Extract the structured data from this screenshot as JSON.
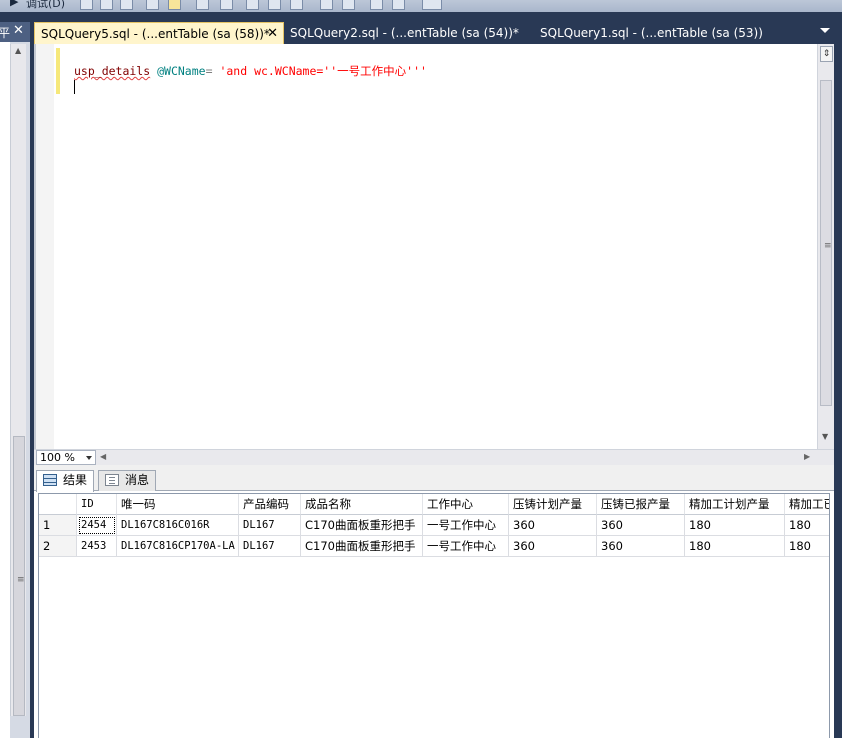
{
  "toolbar": {
    "debug_label": "调试(D)"
  },
  "left_panel": {
    "pin_glyph": "平",
    "close_glyph": "✕"
  },
  "tabs": [
    {
      "label": "SQLQuery5.sql - (...entTable (sa (58))*",
      "active": true,
      "close": "✕"
    },
    {
      "label": "SQLQuery2.sql - (...entTable (sa (54))*",
      "active": false
    },
    {
      "label": "SQLQuery1.sql - (...entTable (sa (53))",
      "active": false
    }
  ],
  "editor": {
    "line1": {
      "proc": "usp_details",
      "var": "@WCName",
      "op": "=",
      "str": "'and wc.WCName=''一号工作中心'''"
    }
  },
  "zoom": {
    "value": "100 %"
  },
  "results": {
    "tabs": [
      {
        "label": "结果",
        "icon": "grid-icon",
        "active": true
      },
      {
        "label": "消息",
        "icon": "messages-icon",
        "active": false
      }
    ],
    "columns": [
      "ID",
      "唯一码",
      "产品编码",
      "成品名称",
      "工作中心",
      "压铸计划产量",
      "压铸已报产量",
      "精加工计划产量",
      "精加工已"
    ],
    "rows": [
      {
        "num": "1",
        "cells": [
          "2454",
          "DL167C816C016R",
          "DL167",
          "C170曲面板重形把手",
          "一号工作中心",
          "360",
          "360",
          "180",
          "180"
        ]
      },
      {
        "num": "2",
        "cells": [
          "2453",
          "DL167C816CP170A-LA",
          "DL167",
          "C170曲面板重形把手",
          "一号工作中心",
          "360",
          "360",
          "180",
          "180"
        ]
      }
    ]
  }
}
